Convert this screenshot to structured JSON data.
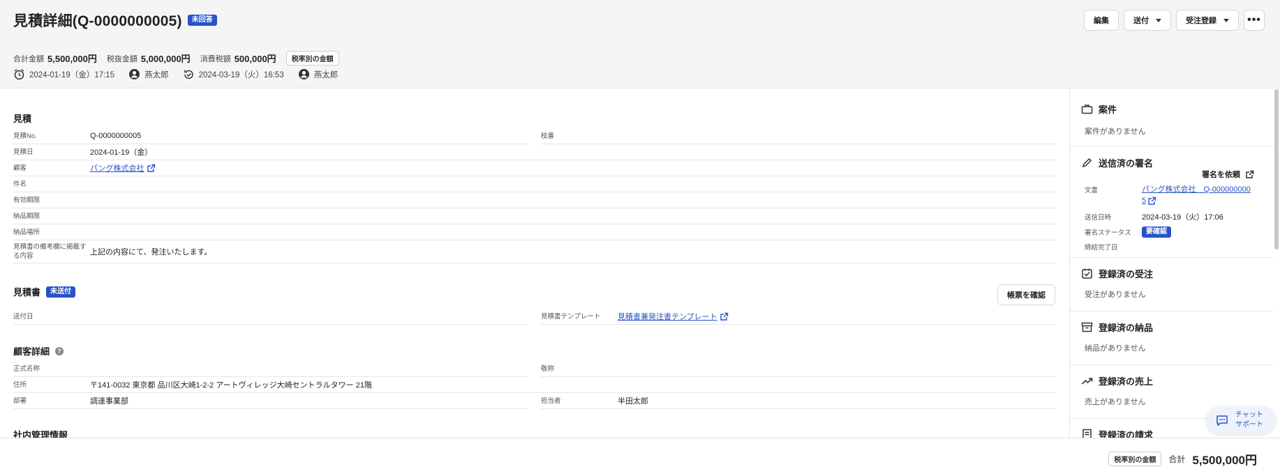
{
  "header": {
    "title": "見積詳細(Q-0000000005)",
    "status_badge": "未回答",
    "actions": {
      "edit": "編集",
      "send": "送付",
      "order": "受注登録",
      "more": "•••"
    },
    "amounts": {
      "total_label": "合計金額",
      "total": "5,500,000円",
      "net_label": "税抜金額",
      "net": "5,000,000円",
      "tax_label": "消費税額",
      "tax": "500,000円",
      "tax_rate_chip": "税率別の金額"
    },
    "meta": {
      "created_at": "2024-01-19（金）17:15",
      "created_by": "燕太郎",
      "updated_at": "2024-03-19（火）16:53",
      "updated_by": "燕太郎"
    }
  },
  "quote": {
    "title": "見積",
    "fields": {
      "no_label": "見積No.",
      "no": "Q-0000000005",
      "branch_label": "枝番",
      "branch": "",
      "date_label": "見積日",
      "date": "2024-01-19（金）",
      "customer_label": "顧客",
      "customer": "パング株式会社",
      "subject_label": "件名",
      "subject": "",
      "valid_label": "有効期限",
      "valid": "",
      "delivery_date_label": "納品期限",
      "delivery_date": "",
      "delivery_place_label": "納品場所",
      "delivery_place": "",
      "notes_label": "見積書の備考欄に掲載する内容",
      "notes": "上記の内容にて、発注いたします。"
    }
  },
  "document": {
    "title": "見積書",
    "badge": "未送付",
    "check_button": "帳票を確認",
    "sent_date_label": "送付日",
    "sent_date": "",
    "template_label": "見積書テンプレート",
    "template": "見積書兼発注書テンプレート"
  },
  "customer_detail": {
    "title": "顧客詳細",
    "formal_name_label": "正式名称",
    "formal_name": "",
    "honorific_label": "敬称",
    "honorific": "",
    "address_label": "住所",
    "address": "〒141-0032 東京都 品川区大崎1-2-2 アートヴィレッジ大崎セントラルタワー 21階",
    "department_label": "部署",
    "department": "調達事業部",
    "person_label": "担当者",
    "person": "半田太郎"
  },
  "internal": {
    "title": "社内管理情報"
  },
  "side": {
    "deal": {
      "title": "案件",
      "empty": "案件がありません"
    },
    "signature": {
      "title": "送信済の署名",
      "request": "署名を依頼",
      "doc_label": "文書",
      "doc_line1": "パング株式会社　Q-000000000",
      "doc_line2": "5",
      "sent_label": "送信日時",
      "sent": "2024-03-19（火）17:06",
      "status_label": "署名ステータス",
      "status": "要確認",
      "done_label": "締結完了日",
      "done": ""
    },
    "orders": {
      "title": "登録済の受注",
      "empty": "受注がありません"
    },
    "deliveries": {
      "title": "登録済の納品",
      "empty": "納品がありません"
    },
    "sales": {
      "title": "登録済の売上",
      "empty": "売上がありません"
    },
    "billing": {
      "title": "登録済の請求"
    }
  },
  "chat": {
    "line1": "チャット",
    "line2": "サポート"
  },
  "footer": {
    "tax_rate_chip": "税率別の金額",
    "total_label": "合計",
    "total": "5,500,000円"
  },
  "colors": {
    "accent": "#2753c5",
    "header_bg": "#f5f5f5"
  }
}
